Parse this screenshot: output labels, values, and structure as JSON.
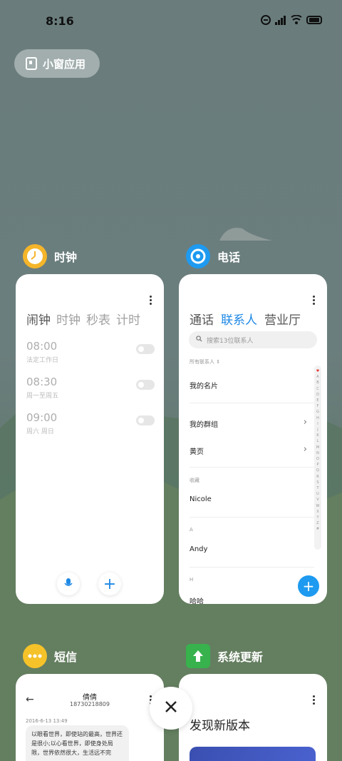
{
  "status": {
    "time": "8:16"
  },
  "floating_pill": {
    "label": "小窗应用"
  },
  "apps": {
    "clock": {
      "name": "时钟",
      "tabs": [
        "闹钟",
        "时钟",
        "秒表",
        "计时"
      ],
      "alarms": [
        {
          "time": "08:00",
          "label": "法定工作日"
        },
        {
          "time": "08:30",
          "label": "周一至周五"
        },
        {
          "time": "09:00",
          "label": "周六 周日"
        }
      ],
      "mic_icon": "mic-icon",
      "add_icon": "plus-icon"
    },
    "phone": {
      "name": "电话",
      "tabs": [
        "通话",
        "联系人",
        "营业厅"
      ],
      "search_placeholder": "搜索13位联系人",
      "all_contacts": "所有联系人",
      "my_card": "我的名片",
      "my_groups": "我的群组",
      "yellow_pages": "黄页",
      "favorites_label": "收藏",
      "favorite_name": "Nicole",
      "section_a": "A",
      "contact_a": "Andy",
      "section_h": "H",
      "contact_h": "哈哈",
      "alphabet": [
        "♥",
        "A",
        "B",
        "C",
        "D",
        "E",
        "F",
        "G",
        "H",
        "I",
        "J",
        "K",
        "L",
        "M",
        "N",
        "O",
        "P",
        "Q",
        "R",
        "S",
        "T",
        "U",
        "V",
        "W",
        "X",
        "Y",
        "Z",
        "#"
      ]
    },
    "messages": {
      "name": "短信",
      "contact_name": "倩倩",
      "contact_number": "18730218809",
      "timestamp": "2016-6-13 13:49",
      "message_text": "以眼看世界，即使站的最高，世界还是很小;以心看世界，即使身处局限，世界依然很大，生活远不完"
    },
    "update": {
      "name": "系统更新",
      "headline": "发现新版本"
    }
  },
  "colors": {
    "accent": "#1e88e5",
    "fab": "#1e9af0"
  }
}
